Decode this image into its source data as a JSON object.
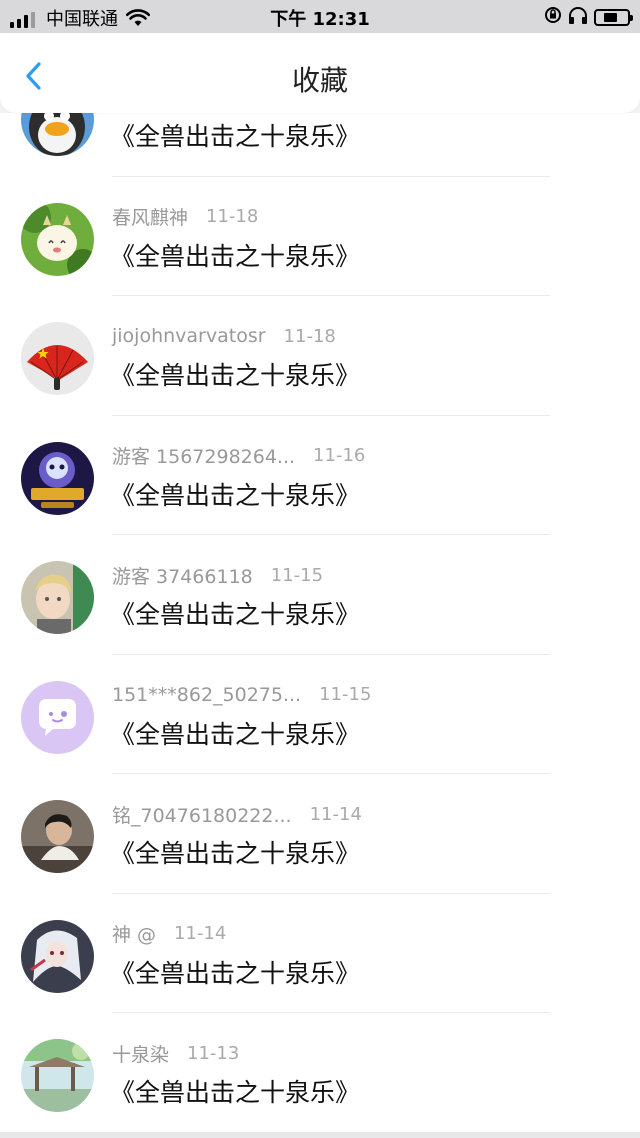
{
  "status_bar": {
    "carrier": "中国联通",
    "time": "下午 12:31",
    "battery_level": 0.45
  },
  "header": {
    "title": "收藏",
    "back_icon": "chevron-left-icon",
    "accent_color": "#2a9df4"
  },
  "items": [
    {
      "user": "",
      "date": "",
      "text": "《全兽出击之十泉乐》",
      "avatar": "penguin-avatar"
    },
    {
      "user": "春风麒神",
      "date": "11-18",
      "text": "《全兽出击之十泉乐》",
      "avatar": "cartoon-goat-avatar"
    },
    {
      "user": "jiojohnvarvatosr",
      "date": "11-18",
      "text": "《全兽出击之十泉乐》",
      "avatar": "fan-flag-avatar"
    },
    {
      "user": "游客 1567298264...",
      "date": "11-16",
      "text": "《全兽出击之十泉乐》",
      "avatar": "game-character-avatar"
    },
    {
      "user": "游客 37466118",
      "date": "11-15",
      "text": "《全兽出击之十泉乐》",
      "avatar": "child-photo-avatar"
    },
    {
      "user": "151***862_50275...",
      "date": "11-15",
      "text": "《全兽出击之十泉乐》",
      "avatar": "default-chat-avatar"
    },
    {
      "user": "铭_70476180222...",
      "date": "11-14",
      "text": "《全兽出击之十泉乐》",
      "avatar": "portrait-photo-avatar"
    },
    {
      "user": "神 @",
      "date": "11-14",
      "text": "《全兽出击之十泉乐》",
      "avatar": "anime-girl-avatar"
    },
    {
      "user": "十泉染",
      "date": "11-13",
      "text": "《全兽出击之十泉乐》",
      "avatar": "garden-scene-avatar"
    }
  ]
}
